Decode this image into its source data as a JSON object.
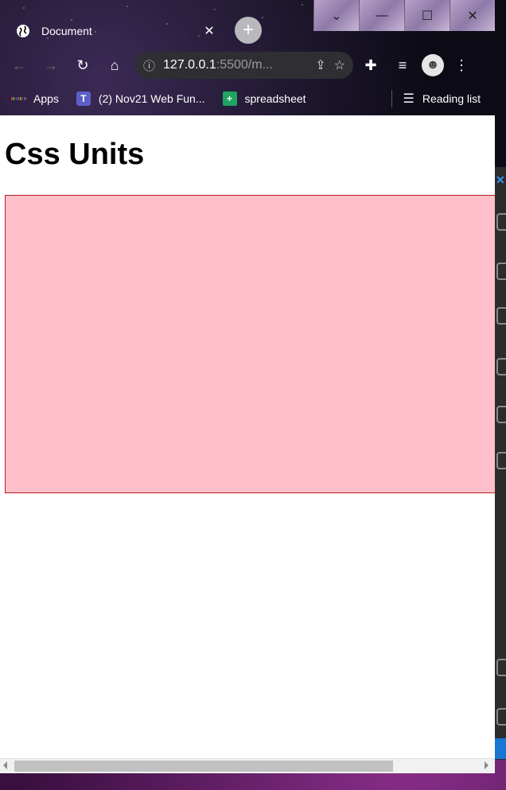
{
  "browser": {
    "tab_title": "Document",
    "tab_close": "✕",
    "new_tab": "+",
    "address_host": "127.0.0.1",
    "address_path": ":5500/m...",
    "bookmarks": [
      {
        "label": "Apps",
        "icon": "apps-grid-icon"
      },
      {
        "label": "(2) Nov21 Web Fun...",
        "icon": "teams-icon"
      },
      {
        "label": "spreadsheet",
        "icon": "sheets-icon"
      }
    ],
    "reading_list": "Reading list"
  },
  "page": {
    "heading": "Css Units",
    "box_color": "#ffc0cb",
    "box_border_color": "#b22222"
  },
  "colors": {
    "chrome_bg": "#000000",
    "omnibox_bg": "#2f2f33",
    "scroll_thumb": "#c1c1c1",
    "vscode_accent": "#3794ff"
  }
}
